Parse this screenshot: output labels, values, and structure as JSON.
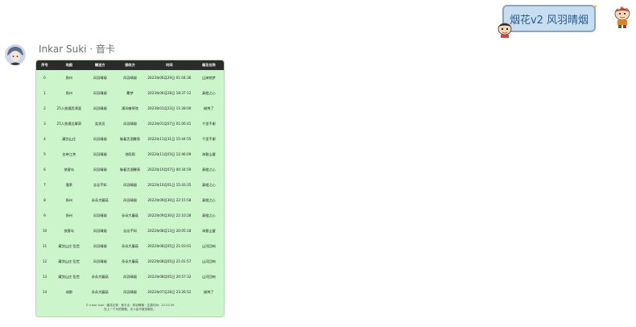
{
  "chat": {
    "sender_name": "Inkar Suki · 音卡",
    "right_message": "烟花v2 风羽晴烟",
    "right_avatar_icon": "cartoon-avatar-icon",
    "left_avatar_icon": "anime-avatar-icon"
  },
  "table": {
    "headers": [
      "序号",
      "地图",
      "赠送方",
      "接收方",
      "时间",
      "烟花名称"
    ],
    "rows": [
      [
        "0",
        "扬州",
        "风羽晴烟",
        "风羽晴烟",
        "2023年06月29日 01:04:36",
        "山海铭梦"
      ],
      [
        "1",
        "扬州",
        "风羽晴烟",
        "覆梦",
        "2023年06月28日 18:37:12",
        "真橙之心"
      ],
      [
        "2",
        "25人普通西津渡",
        "风羽晴烟",
        "满风敏琴弦",
        "2023年01月23日 11:28:00",
        "椒荆了"
      ],
      [
        "3",
        "25人普通达摩洞",
        "笑浪员",
        "风羽晴烟",
        "2023年01月07日 01:06:41",
        "千里不谢"
      ],
      [
        "4",
        "藏剑山庄",
        "风羽晴烟",
        "躲着舌酒鞭表",
        "2022年11月31日 15:44:55",
        "千里不谢"
      ],
      [
        "5",
        "台帝江关",
        "风羽晴烟",
        "池阳照",
        "2022年11月03日 12:46:09",
        "海誓山盟"
      ],
      [
        "6",
        "侠客岛",
        "风羽晴烟",
        "躲着舌酒鞭表",
        "2022年10月07日 00:34:59",
        "真橙之心"
      ],
      [
        "7",
        "蓬莱",
        "念念不知",
        "风羽晴烟",
        "2022年10月01日 15:43:35",
        "真橙之心"
      ],
      [
        "8",
        "扬州",
        "朵朵大蘑菇",
        "风羽晴烟",
        "2022年09月30日 22:15:58",
        "真橙之心"
      ],
      [
        "9",
        "扬州",
        "风羽晴烟",
        "朵朵大蘑菇",
        "2022年09月30日 22:10:28",
        "真橙之心"
      ],
      [
        "10",
        "侠客岛",
        "风羽晴烟",
        "念念不知",
        "2022年08月13日 20:05:18",
        "海誓山盟"
      ],
      [
        "11",
        "藏剑山庄·乱世",
        "风羽晴烟",
        "朵朵大蘑菇",
        "2022年08月05日 21:03:01",
        "山河回响"
      ],
      [
        "12",
        "藏剑山庄·乱世",
        "风羽晴烟",
        "朵朵大蘑菇",
        "2022年08月05日 21:01:57",
        "山河回响"
      ],
      [
        "13",
        "藏剑山庄·乱世",
        "朵朵大蘑菇",
        "风羽晴烟",
        "2022年08月05日 20:57:32",
        "山河回响"
      ],
      [
        "14",
        "成都",
        "朵朵大蘑菇",
        "风羽晴烟",
        "2022年07月28日 23:26:52",
        "椒荆了"
      ]
    ],
    "footer_line1": "© Inkar Suki · 烟花记录 · 音卡出 · 风羽晴烟 · 生成时间：22:23:39",
    "footer_line2": "仅上一个月的数据，无人会不被加烟花。"
  }
}
